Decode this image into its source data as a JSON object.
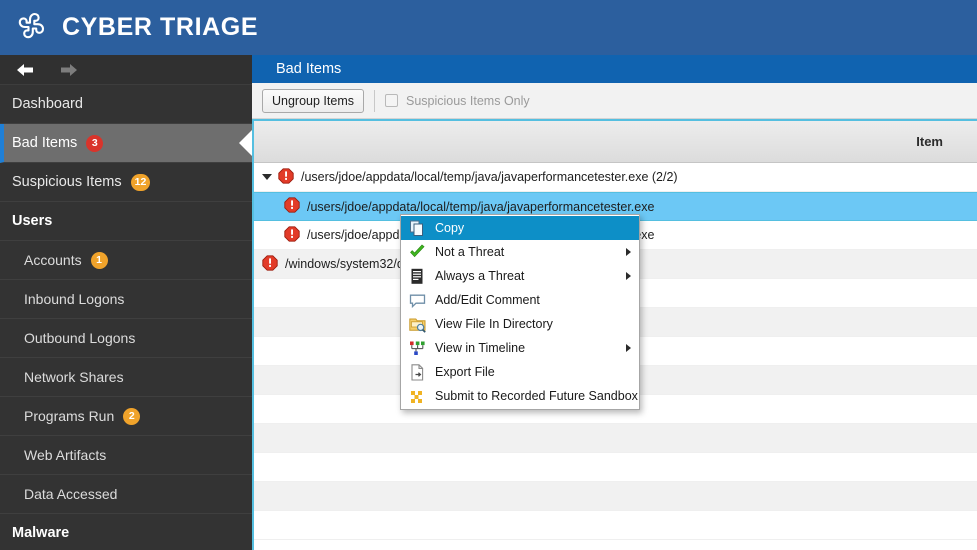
{
  "brand": {
    "title": "CYBER TRIAGE",
    "logo_icon": "pinwheel-logo-icon",
    "bar_color": "#2c5f9e"
  },
  "nav": {
    "back_icon": "arrow-left-icon",
    "forward_icon": "arrow-right-icon"
  },
  "sidebar": {
    "items": [
      {
        "label": "Dashboard",
        "badge": null,
        "badge_color": null,
        "kind": "item",
        "selected": false
      },
      {
        "label": "Bad Items",
        "badge": "3",
        "badge_color": "#d9342b",
        "kind": "item",
        "selected": true
      },
      {
        "label": "Suspicious Items",
        "badge": "12",
        "badge_color": "#f0a32b",
        "kind": "item",
        "selected": false
      },
      {
        "label": "Users",
        "badge": null,
        "badge_color": null,
        "kind": "group",
        "selected": false
      },
      {
        "label": "Accounts",
        "badge": "1",
        "badge_color": "#f0a32b",
        "kind": "indent",
        "selected": false
      },
      {
        "label": "Inbound Logons",
        "badge": null,
        "badge_color": null,
        "kind": "indent",
        "selected": false
      },
      {
        "label": "Outbound Logons",
        "badge": null,
        "badge_color": null,
        "kind": "indent",
        "selected": false
      },
      {
        "label": "Network Shares",
        "badge": null,
        "badge_color": null,
        "kind": "indent",
        "selected": false
      },
      {
        "label": "Programs Run",
        "badge": "2",
        "badge_color": "#f0a32b",
        "kind": "indent",
        "selected": false
      },
      {
        "label": "Web Artifacts",
        "badge": null,
        "badge_color": null,
        "kind": "indent",
        "selected": false
      },
      {
        "label": "Data Accessed",
        "badge": null,
        "badge_color": null,
        "kind": "indent",
        "selected": false
      },
      {
        "label": "Malware",
        "badge": null,
        "badge_color": null,
        "kind": "group",
        "selected": false
      }
    ]
  },
  "main": {
    "title": "Bad Items",
    "title_bar_color": "#1063b0",
    "toolbar": {
      "ungroup_button": "Ungroup Items",
      "suspicious_only_label": "Suspicious Items Only",
      "suspicious_only_checked": false
    },
    "table": {
      "column_header": "Item",
      "rows": [
        {
          "text": "/users/jdoe/appdata/local/temp/java/javaperformancetester.exe (2/2)",
          "level": 0,
          "expanded": true,
          "selected": false,
          "icon": "error-octagon-icon",
          "stripe": "odd"
        },
        {
          "text": "/users/jdoe/appdata/local/temp/java/javaperformancetester.exe",
          "level": 1,
          "expanded": false,
          "selected": true,
          "icon": "error-octagon-icon",
          "stripe": "sel"
        },
        {
          "text": "/users/jdoe/appdata/local/temp/java/javaperformancetester.exe",
          "level": 1,
          "expanded": false,
          "selected": false,
          "icon": "error-octagon-icon",
          "stripe": "odd"
        },
        {
          "text": "/windows/system32/drivers/etc/hosts.exe",
          "level": 0,
          "expanded": false,
          "selected": false,
          "icon": "error-octagon-icon",
          "stripe": "even"
        }
      ],
      "empty_row_count": 9
    }
  },
  "context_menu": {
    "highlight_color": "#0d8fc7",
    "items": [
      {
        "label": "Copy",
        "icon": "copy-icon",
        "submenu": false,
        "active": true
      },
      {
        "label": "Not a Threat",
        "icon": "green-check-icon",
        "submenu": true,
        "active": false
      },
      {
        "label": "Always a Threat",
        "icon": "document-list-icon",
        "submenu": true,
        "active": false
      },
      {
        "label": "Add/Edit Comment",
        "icon": "comment-bubble-icon",
        "submenu": false,
        "active": false
      },
      {
        "label": "View File In Directory",
        "icon": "folder-search-icon",
        "submenu": false,
        "active": false
      },
      {
        "label": "View in Timeline",
        "icon": "timeline-tree-icon",
        "submenu": true,
        "active": false
      },
      {
        "label": "Export File",
        "icon": "export-file-icon",
        "submenu": false,
        "active": false
      },
      {
        "label": "Submit to Recorded Future Sandbox",
        "icon": "sandbox-dots-icon",
        "submenu": false,
        "active": false
      }
    ]
  }
}
